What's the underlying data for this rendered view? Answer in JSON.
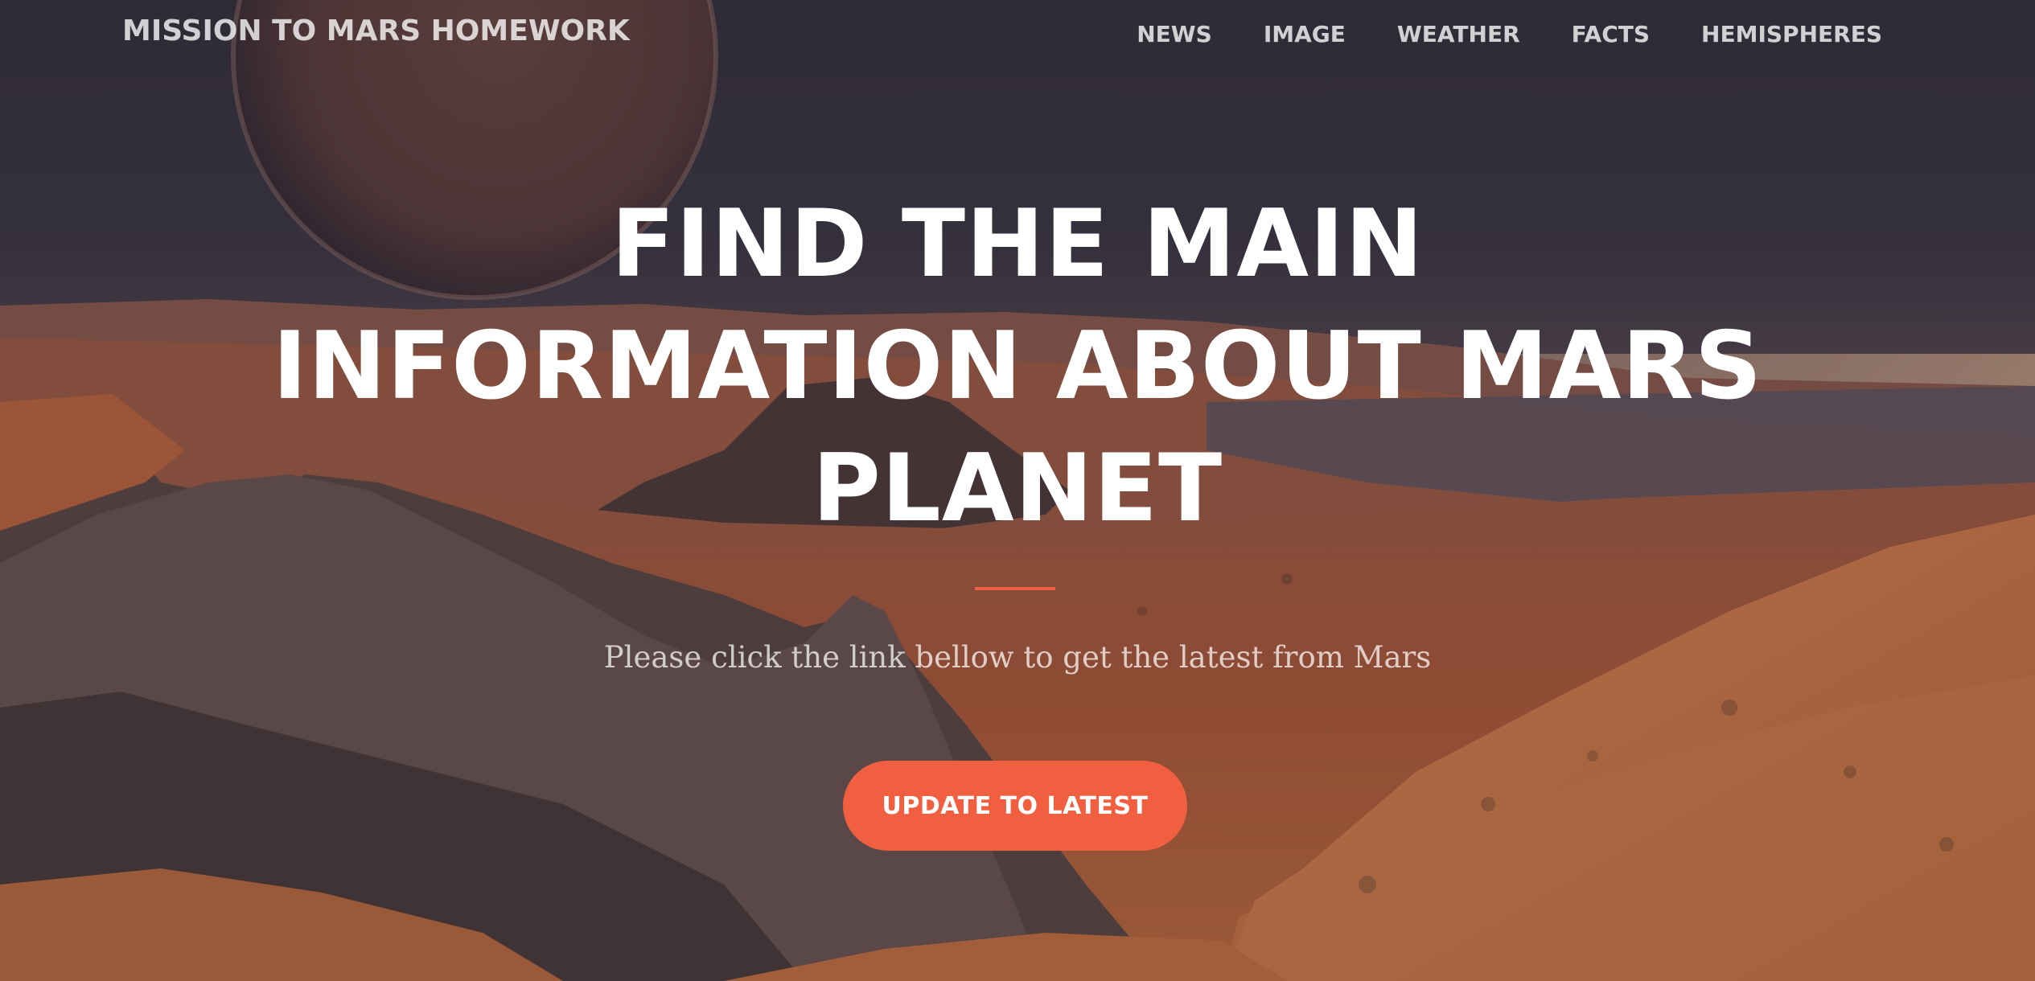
{
  "navbar": {
    "brand": "MISSION TO MARS HOMEWORK",
    "links": [
      "NEWS",
      "IMAGE",
      "WEATHER",
      "FACTS",
      "HEMISPHERES"
    ]
  },
  "hero": {
    "headline_lines": [
      "FIND THE MAIN",
      "INFORMATION ABOUT MARS",
      "PLANET"
    ],
    "subtitle": "Please click the link bellow to get the latest from Mars",
    "cta_label": "UPDATE TO LATEST"
  },
  "colors": {
    "accent": "#f05f40",
    "sky": "#3d3a45",
    "terrain": "#b8633d",
    "text": "#ffffff"
  },
  "icons": {
    "background": "mars-landscape-image"
  }
}
